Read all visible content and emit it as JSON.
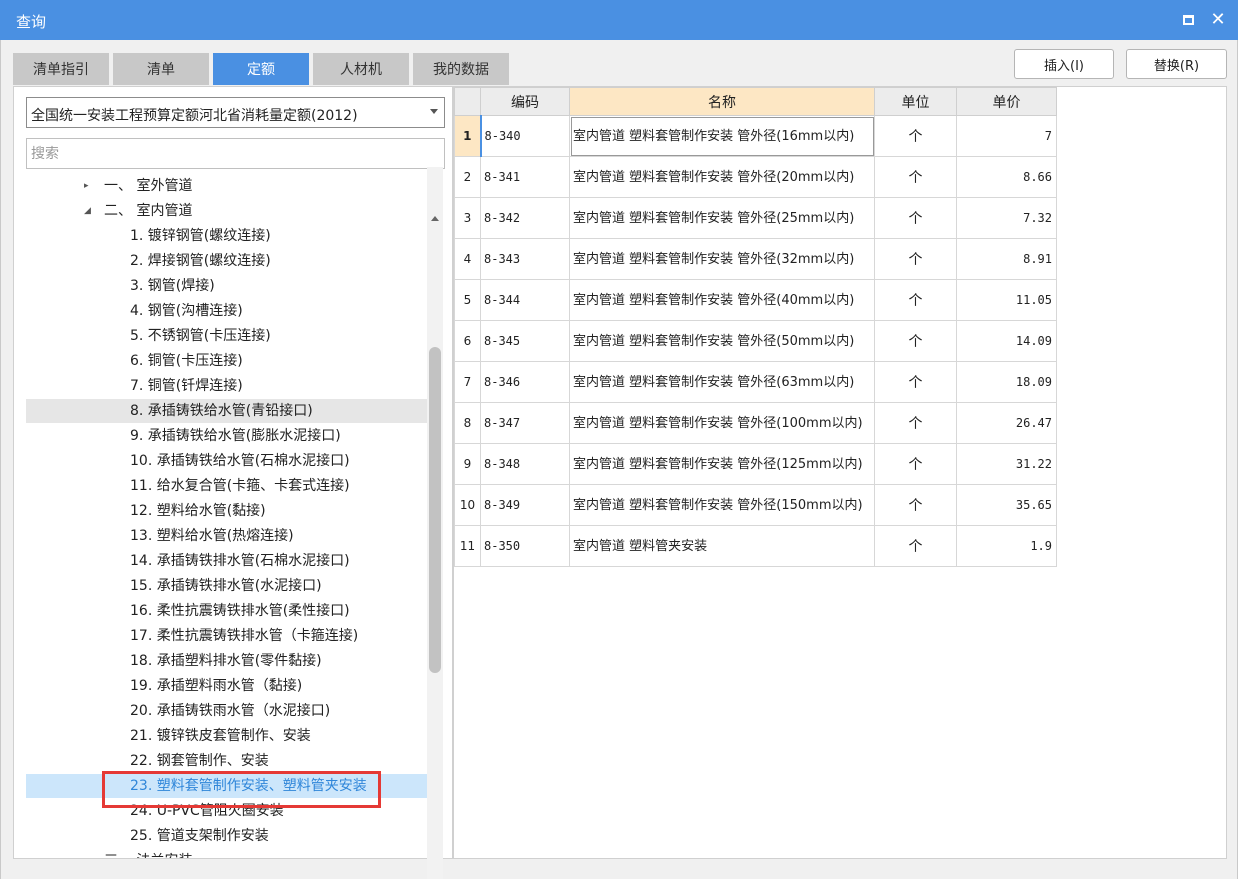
{
  "window": {
    "title": "查询"
  },
  "tabs": [
    "清单指引",
    "清单",
    "定额",
    "人材机",
    "我的数据"
  ],
  "active_tab": "定额",
  "actions": {
    "insert": "插入(I)",
    "replace": "替换(R)"
  },
  "left": {
    "select_value": "全国统一安装工程预算定额河北省消耗量定额(2012)",
    "search_placeholder": "搜索",
    "tree": [
      {
        "label": "一、 室外管道",
        "level": 1,
        "arrow": "▸"
      },
      {
        "label": "二、 室内管道",
        "level": 1,
        "arrow": "◢"
      },
      {
        "label": "1. 镀锌钢管(螺纹连接)",
        "level": 2
      },
      {
        "label": "2. 焊接钢管(螺纹连接)",
        "level": 2
      },
      {
        "label": "3. 钢管(焊接)",
        "level": 2
      },
      {
        "label": "4. 钢管(沟槽连接)",
        "level": 2
      },
      {
        "label": "5. 不锈钢管(卡压连接)",
        "level": 2
      },
      {
        "label": "6. 铜管(卡压连接)",
        "level": 2
      },
      {
        "label": "7. 铜管(钎焊连接)",
        "level": 2
      },
      {
        "label": "8. 承插铸铁给水管(青铅接口)",
        "level": 2,
        "state": "hover"
      },
      {
        "label": "9. 承插铸铁给水管(膨胀水泥接口)",
        "level": 2
      },
      {
        "label": "10. 承插铸铁给水管(石棉水泥接口)",
        "level": 2
      },
      {
        "label": "11. 给水复合管(卡箍、卡套式连接)",
        "level": 2
      },
      {
        "label": "12. 塑料给水管(黏接)",
        "level": 2
      },
      {
        "label": "13. 塑料给水管(热熔连接)",
        "level": 2
      },
      {
        "label": "14. 承插铸铁排水管(石棉水泥接口)",
        "level": 2
      },
      {
        "label": "15. 承插铸铁排水管(水泥接口)",
        "level": 2
      },
      {
        "label": "16. 柔性抗震铸铁排水管(柔性接口)",
        "level": 2
      },
      {
        "label": "17. 柔性抗震铸铁排水管（卡箍连接)",
        "level": 2
      },
      {
        "label": "18. 承插塑料排水管(零件黏接)",
        "level": 2
      },
      {
        "label": "19. 承插塑料雨水管（黏接)",
        "level": 2
      },
      {
        "label": "20. 承插铸铁雨水管（水泥接口)",
        "level": 2
      },
      {
        "label": "21. 镀锌铁皮套管制作、安装",
        "level": 2
      },
      {
        "label": "22. 钢套管制作、安装",
        "level": 2
      },
      {
        "label": "23. 塑料套管制作安装、塑料管夹安装",
        "level": 2,
        "state": "selected"
      },
      {
        "label": "24. U-PVC管阻火圈安装",
        "level": 2
      },
      {
        "label": "25. 管道支架制作安装",
        "level": 2
      },
      {
        "label": "三、 法兰安装",
        "level": 1,
        "arrow": "▸"
      }
    ]
  },
  "grid": {
    "headers": {
      "code": "编码",
      "name": "名称",
      "unit": "单位",
      "price": "单价"
    },
    "rows": [
      {
        "idx": "1",
        "code": "8-340",
        "name": "室内管道 塑料套管制作安装 管外径(16mm以内)",
        "unit": "个",
        "price": "7"
      },
      {
        "idx": "2",
        "code": "8-341",
        "name": "室内管道 塑料套管制作安装 管外径(20mm以内)",
        "unit": "个",
        "price": "8.66"
      },
      {
        "idx": "3",
        "code": "8-342",
        "name": "室内管道 塑料套管制作安装 管外径(25mm以内)",
        "unit": "个",
        "price": "7.32"
      },
      {
        "idx": "4",
        "code": "8-343",
        "name": "室内管道 塑料套管制作安装 管外径(32mm以内)",
        "unit": "个",
        "price": "8.91"
      },
      {
        "idx": "5",
        "code": "8-344",
        "name": "室内管道 塑料套管制作安装 管外径(40mm以内)",
        "unit": "个",
        "price": "11.05"
      },
      {
        "idx": "6",
        "code": "8-345",
        "name": "室内管道 塑料套管制作安装 管外径(50mm以内)",
        "unit": "个",
        "price": "14.09"
      },
      {
        "idx": "7",
        "code": "8-346",
        "name": "室内管道 塑料套管制作安装 管外径(63mm以内)",
        "unit": "个",
        "price": "18.09"
      },
      {
        "idx": "8",
        "code": "8-347",
        "name": "室内管道 塑料套管制作安装 管外径(100mm以内)",
        "unit": "个",
        "price": "26.47"
      },
      {
        "idx": "9",
        "code": "8-348",
        "name": "室内管道 塑料套管制作安装 管外径(125mm以内)",
        "unit": "个",
        "price": "31.22"
      },
      {
        "idx": "10",
        "code": "8-349",
        "name": "室内管道 塑料套管制作安装 管外径(150mm以内)",
        "unit": "个",
        "price": "35.65"
      },
      {
        "idx": "11",
        "code": "8-350",
        "name": "室内管道 塑料管夹安装",
        "unit": "个",
        "price": "1.9"
      }
    ]
  },
  "colors": {
    "accent": "#4a90e2",
    "selected_bg": "#cce6fb",
    "highlight_border": "#e53935",
    "name_header_bg": "#fde7c4"
  }
}
